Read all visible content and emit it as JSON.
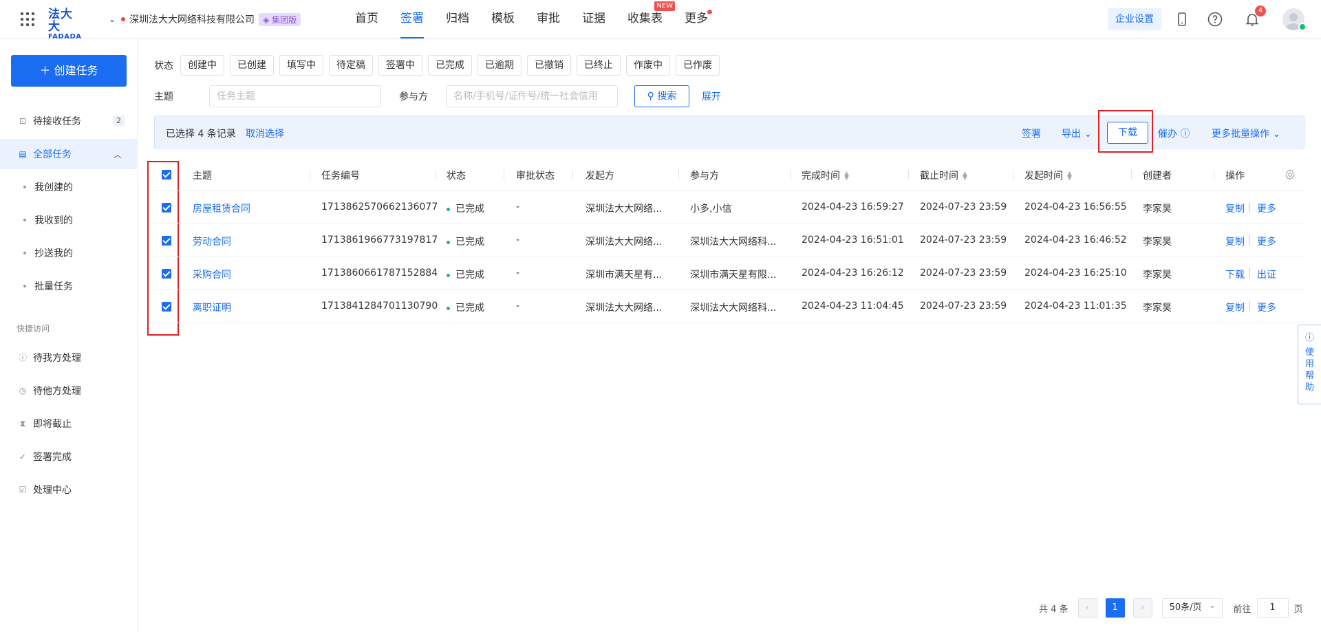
{
  "header": {
    "logo_cn": "法大大",
    "logo_en": "FADADA",
    "company": "深圳法大大网络科技有限公司",
    "edition": "集团版",
    "nav": [
      {
        "label": "首页"
      },
      {
        "label": "签署",
        "active": true
      },
      {
        "label": "归档"
      },
      {
        "label": "模板"
      },
      {
        "label": "审批"
      },
      {
        "label": "证据"
      },
      {
        "label": "收集表",
        "badge": "NEW"
      },
      {
        "label": "更多",
        "dot": true
      }
    ],
    "enterprise_settings": "企业设置",
    "notification_count": "4"
  },
  "sidebar": {
    "create_task": "创建任务",
    "pending_receive": {
      "label": "待接收任务",
      "count": "2"
    },
    "all_tasks": "全部任务",
    "sub_items": [
      "我创建的",
      "我收到的",
      "抄送我的",
      "批量任务"
    ],
    "quick_access_title": "快捷访问",
    "quick_items": [
      "待我方处理",
      "待他方处理",
      "即将截止",
      "签署完成",
      "处理中心"
    ]
  },
  "filters": {
    "status_label": "状态",
    "statuses": [
      "创建中",
      "已创建",
      "填写中",
      "待定稿",
      "签署中",
      "已完成",
      "已逾期",
      "已撤销",
      "已终止",
      "作废中",
      "已作废"
    ],
    "subject_label": "主题",
    "subject_placeholder": "任务主题",
    "participant_label": "参与方",
    "participant_placeholder": "名称/手机号/证件号/统一社会信用",
    "search": "搜索",
    "expand": "展开"
  },
  "selection_bar": {
    "selected_text": "已选择 4 条记录",
    "cancel": "取消选择",
    "sign": "签署",
    "export": "导出",
    "download": "下载",
    "remind": "催办",
    "more_batch": "更多批量操作"
  },
  "table": {
    "columns": [
      "主题",
      "任务编号",
      "状态",
      "审批状态",
      "发起方",
      "参与方",
      "完成时间",
      "截止时间",
      "发起时间",
      "创建者",
      "操作"
    ],
    "rows": [
      {
        "subject": "房屋租赁合同",
        "id": "1713862570662136077",
        "status": "已完成",
        "approval": "-",
        "initiator": "深圳法大大网络...",
        "participant": "小多,小信",
        "completed": "2024-04-23 16:59:27",
        "deadline": "2024-07-23 23:59",
        "started": "2024-04-23 16:56:55",
        "creator": "李家昊",
        "op1": "复制",
        "op2": "更多"
      },
      {
        "subject": "劳动合同",
        "id": "1713861966773197817",
        "status": "已完成",
        "approval": "-",
        "initiator": "深圳法大大网络...",
        "participant": "深圳法大大网络科...",
        "completed": "2024-04-23 16:51:01",
        "deadline": "2024-07-23 23:59",
        "started": "2024-04-23 16:46:52",
        "creator": "李家昊",
        "op1": "复制",
        "op2": "更多"
      },
      {
        "subject": "采购合同",
        "id": "1713860661787152884",
        "status": "已完成",
        "approval": "-",
        "initiator": "深圳市满天星有...",
        "participant": "深圳市满天星有限...",
        "completed": "2024-04-23 16:26:12",
        "deadline": "2024-07-23 23:59",
        "started": "2024-04-23 16:25:10",
        "creator": "李家昊",
        "op1": "下载",
        "op2": "出证"
      },
      {
        "subject": "离职证明",
        "id": "1713841284701130790",
        "status": "已完成",
        "approval": "-",
        "initiator": "深圳法大大网络...",
        "participant": "深圳法大大网络科...",
        "completed": "2024-04-23 11:04:45",
        "deadline": "2024-07-23 23:59",
        "started": "2024-04-23 11:01:35",
        "creator": "李家昊",
        "op1": "复制",
        "op2": "更多"
      }
    ]
  },
  "help": "使用帮助",
  "pagination": {
    "total": "共 4 条",
    "current": "1",
    "page_size": "50条/页",
    "goto_label": "前往",
    "goto_value": "1",
    "page_unit": "页"
  }
}
